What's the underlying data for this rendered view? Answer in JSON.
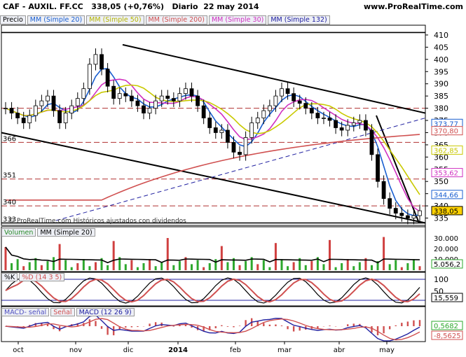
{
  "header": {
    "title": "CAF - AUXIL. FF.CC",
    "price_change": "338,05 (+0,76%)",
    "period": "Diario",
    "date": "22 may 2014",
    "brand": "www.ProRealTime.com"
  },
  "main_legend": [
    {
      "label": "Precio",
      "color": "#000000"
    },
    {
      "label": "MM (Simple 20)",
      "color": "#1a5fd0"
    },
    {
      "label": "MM (Simple 50)",
      "color": "#c9c900"
    },
    {
      "label": "MM (Simple 200)",
      "color": "#d05050"
    },
    {
      "label": "MM (Simple 30)",
      "color": "#d030c0"
    },
    {
      "label": "MM (Simple 132)",
      "color": "#2020a0"
    }
  ],
  "watermark": "© ProRealTime.com Históricos ajustados con dividendos",
  "price_panel": {
    "yticks": [
      335,
      340,
      345,
      350,
      355,
      360,
      365,
      370,
      375,
      380,
      385,
      390,
      395,
      400,
      405,
      410
    ],
    "ytick_labels": [
      "335",
      "340",
      "345",
      "350",
      "355",
      "360",
      "365",
      "370",
      "375",
      "380",
      "385",
      "390",
      "395",
      "400",
      "405",
      "410"
    ],
    "left_labels": [
      "366",
      "351",
      "340",
      "333"
    ],
    "right_badges": [
      {
        "text": "373,77",
        "color": "#1a5fd0"
      },
      {
        "text": "370,80",
        "color": "#d05050"
      },
      {
        "text": "362,85",
        "color": "#c9c900"
      },
      {
        "text": "353,62",
        "color": "#d030c0"
      },
      {
        "text": "344,66",
        "color": "#1a5fd0"
      },
      {
        "text": "338,05",
        "color": "#000000"
      }
    ]
  },
  "volume_panel": {
    "legend": [
      "Volumen",
      "MM (Simple 20)"
    ],
    "yticks": [
      "30.000",
      "20.000",
      "10.000"
    ],
    "badge": "5.056,2"
  },
  "stoch_panel": {
    "legend": [
      "%K",
      "%D (14 3 5)"
    ],
    "yticks": [
      "100",
      "50"
    ],
    "badge": "15,559"
  },
  "macd_panel": {
    "legend": [
      "MACD- señal",
      "Señal",
      "MACD (12 26 9)"
    ],
    "badges": [
      "0,5682",
      "-8,5625"
    ]
  },
  "x_labels": [
    "oct",
    "nov",
    "dic",
    "2014",
    "feb",
    "mar",
    "abr",
    "may"
  ],
  "chart_data": {
    "type": "candlestick",
    "title": "CAF - AUXIL. FF.CC",
    "ylim": [
      332,
      414
    ],
    "close_series_approx": [
      380,
      378,
      376,
      374,
      377,
      381,
      383,
      385,
      379,
      374,
      378,
      381,
      384,
      388,
      398,
      402,
      396,
      389,
      384,
      386,
      385,
      383,
      381,
      378,
      380,
      383,
      385,
      384,
      383,
      386,
      388,
      385,
      381,
      376,
      372,
      370,
      371,
      366,
      362,
      361,
      368,
      374,
      376,
      379,
      381,
      385,
      388,
      386,
      383,
      382,
      380,
      378,
      376,
      376,
      375,
      372,
      371,
      373,
      374,
      375,
      371,
      361,
      350,
      343,
      339,
      337,
      336,
      335,
      336,
      338
    ],
    "last_close": 338.05,
    "change_pct": 0.76
  }
}
